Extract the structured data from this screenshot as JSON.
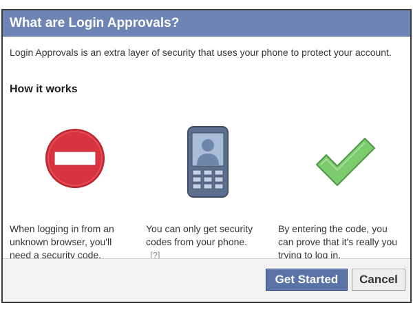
{
  "dialog": {
    "title": "What are Login Approvals?",
    "intro": "Login Approvals is an extra layer of security that uses your phone to protect your account.",
    "heading": "How it works",
    "steps": [
      {
        "icon": "no-entry-icon",
        "text": "When logging in from an unknown browser, you'll need a security code."
      },
      {
        "icon": "mobile-phone-icon",
        "text": "You can only get security codes from your phone.",
        "help": "[?]"
      },
      {
        "icon": "checkmark-icon",
        "text": "By entering the code, you can prove that it's really you trying to log in."
      }
    ],
    "buttons": {
      "primary": "Get Started",
      "secondary": "Cancel"
    }
  },
  "colors": {
    "titlebar": "#6d84b4",
    "primary_button": "#5b74a8",
    "no_entry_red": "#d8343f",
    "check_green": "#7ccb6f"
  }
}
